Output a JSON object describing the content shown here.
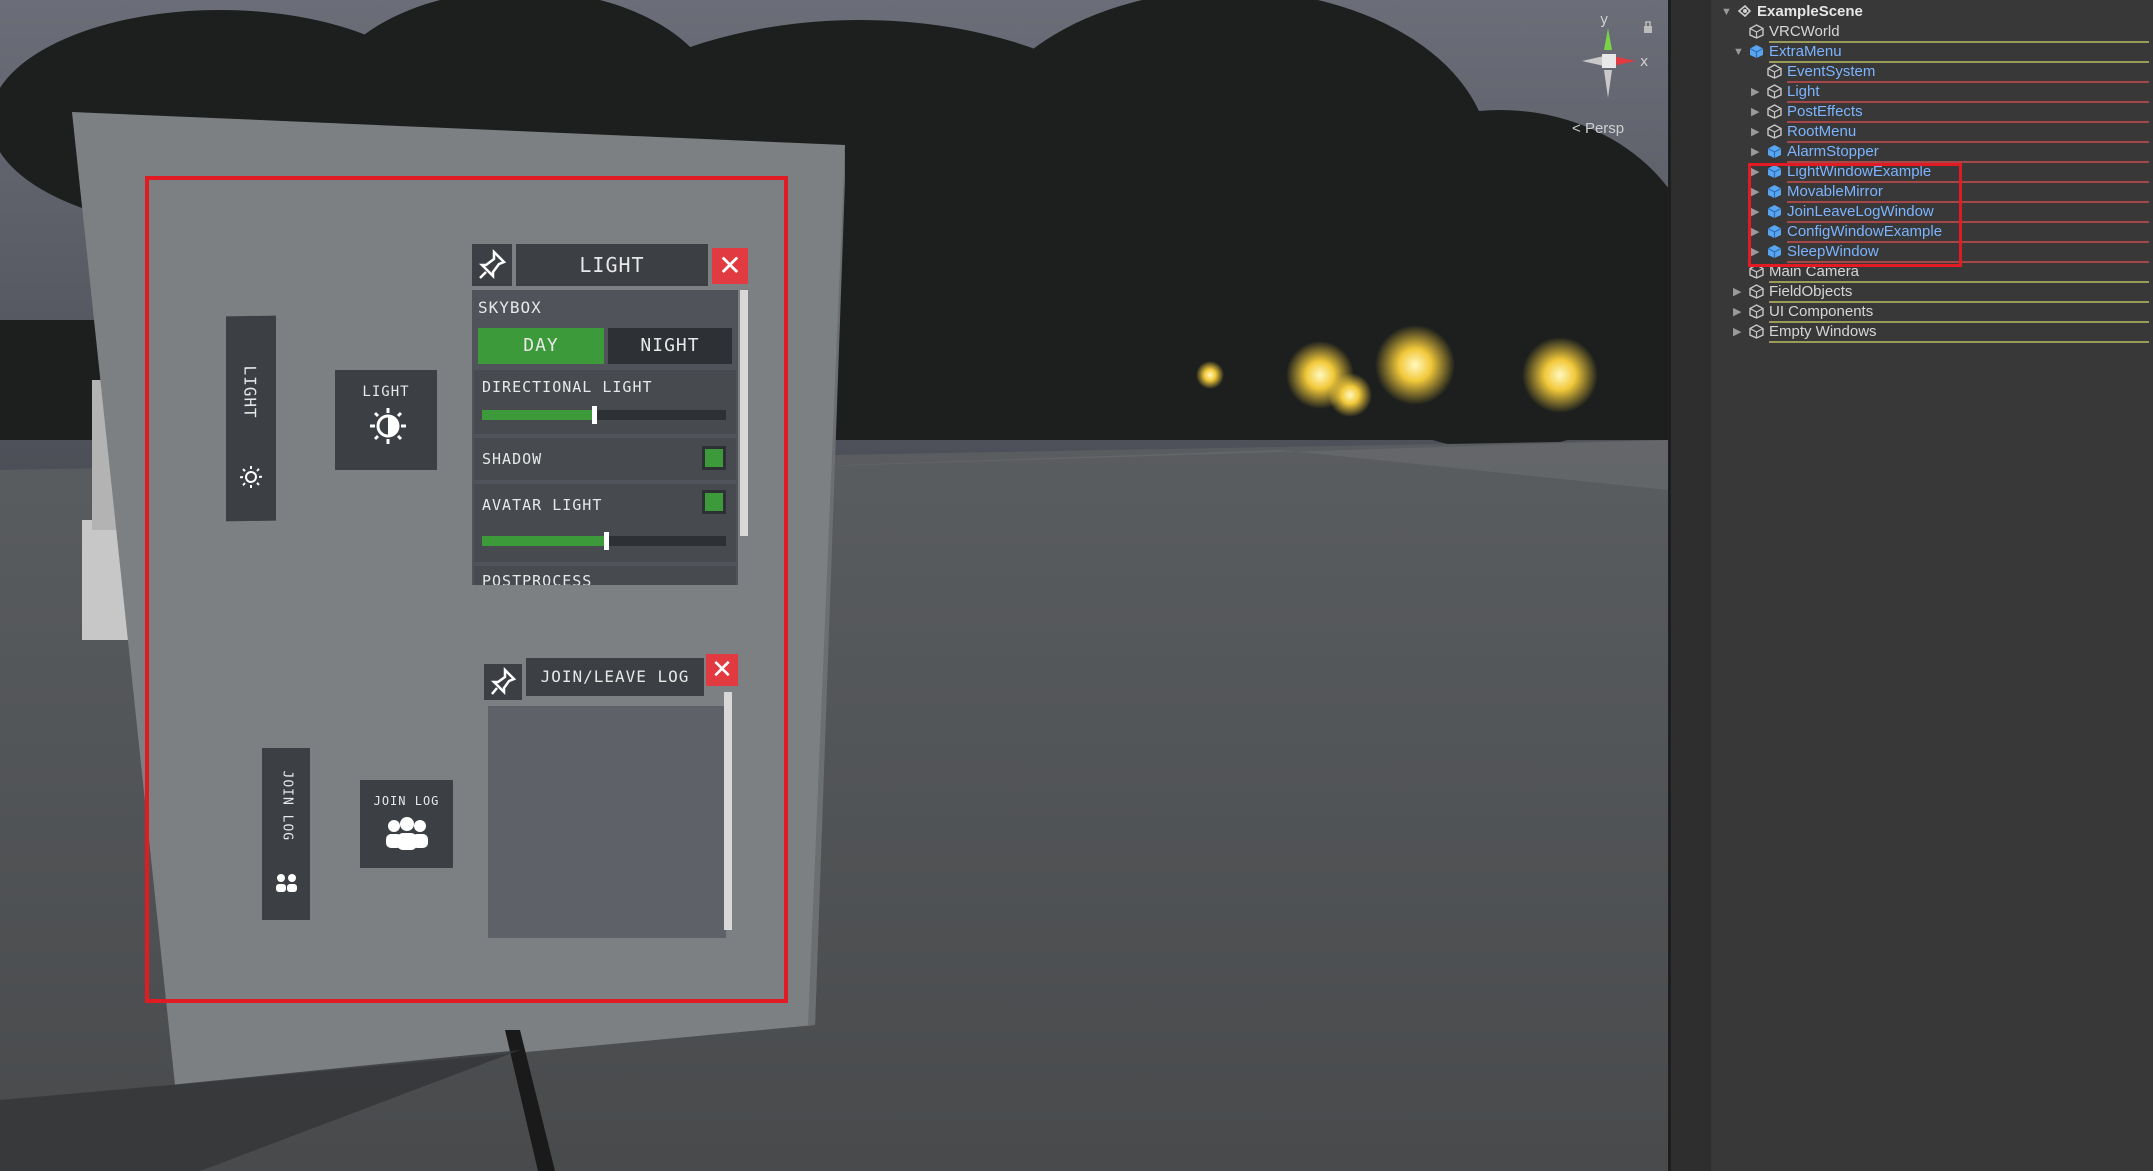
{
  "scene": {
    "gizmo": {
      "axis_y": "y",
      "axis_x": "x",
      "projection": "Persp"
    },
    "panel": {
      "light_tab": {
        "label": "LIGHT",
        "icon": "sun-icon"
      },
      "light_button": {
        "label": "LIGHT",
        "icon": "brightness-icon"
      },
      "join_tab": {
        "label": "JOIN LOG",
        "icon": "people-icon"
      },
      "join_button": {
        "label": "JOIN LOG",
        "icon": "people-icon"
      }
    },
    "light_window": {
      "title": "LIGHT",
      "pin_icon": "pin-icon",
      "close_icon": "close-icon",
      "skybox_label": "SKYBOX",
      "day_label": "DAY",
      "night_label": "NIGHT",
      "skybox_selected": "DAY",
      "directional_label": "DIRECTIONAL LIGHT",
      "directional_value": 0.45,
      "shadow_label": "SHADOW",
      "shadow_checked": true,
      "avatar_label": "AVATAR LIGHT",
      "avatar_checked": true,
      "avatar_value": 0.5,
      "postprocess_label": "POSTPROCESS"
    },
    "join_window": {
      "title": "JOIN/LEAVE LOG",
      "pin_icon": "pin-icon",
      "close_icon": "close-icon"
    }
  },
  "hierarchy": {
    "root": "ExampleScene",
    "items": [
      {
        "label": "VRCWorld",
        "depth": 1,
        "expander": "none",
        "icon": "gameobject-icon",
        "color": "#d6d6d6",
        "line": "#9a9a5a"
      },
      {
        "label": "ExtraMenu",
        "depth": 1,
        "expander": "open",
        "icon": "prefab-icon",
        "color": "#7cb4ff",
        "line": "#9a9a5a"
      },
      {
        "label": "EventSystem",
        "depth": 2,
        "expander": "none",
        "icon": "gameobject-icon",
        "color": "#7cb4ff",
        "line": "#a64646"
      },
      {
        "label": "Light",
        "depth": 2,
        "expander": "closed",
        "icon": "gameobject-icon",
        "color": "#7cb4ff",
        "line": "#a64646"
      },
      {
        "label": "PostEffects",
        "depth": 2,
        "expander": "closed",
        "icon": "gameobject-icon",
        "color": "#7cb4ff",
        "line": "#a64646"
      },
      {
        "label": "RootMenu",
        "depth": 2,
        "expander": "closed",
        "icon": "gameobject-icon",
        "color": "#7cb4ff",
        "line": "#a64646"
      },
      {
        "label": "AlarmStopper",
        "depth": 2,
        "expander": "closed",
        "icon": "prefab-icon",
        "color": "#7cb4ff",
        "line": "#a64646"
      },
      {
        "label": "LightWindowExample",
        "depth": 2,
        "expander": "closed",
        "icon": "prefab-icon",
        "color": "#7cb4ff",
        "line": "#a64646"
      },
      {
        "label": "MovableMirror",
        "depth": 2,
        "expander": "closed",
        "icon": "prefab-icon",
        "color": "#7cb4ff",
        "line": "#a64646"
      },
      {
        "label": "JoinLeaveLogWindow",
        "depth": 2,
        "expander": "closed",
        "icon": "prefab-icon",
        "color": "#7cb4ff",
        "line": "#a64646"
      },
      {
        "label": "ConfigWindowExample",
        "depth": 2,
        "expander": "closed",
        "icon": "prefab-icon",
        "color": "#7cb4ff",
        "line": "#a64646"
      },
      {
        "label": "SleepWindow",
        "depth": 2,
        "expander": "closed",
        "icon": "prefab-icon",
        "color": "#7cb4ff",
        "line": "#a64646"
      },
      {
        "label": "Main Camera",
        "depth": 1,
        "expander": "none",
        "icon": "gameobject-icon",
        "color": "#d6d6d6",
        "line": "#9a9a5a"
      },
      {
        "label": "FieldObjects",
        "depth": 1,
        "expander": "closed",
        "icon": "gameobject-icon",
        "color": "#d6d6d6",
        "line": "#9a9a5a"
      },
      {
        "label": "UI Components",
        "depth": 1,
        "expander": "closed",
        "icon": "gameobject-icon",
        "color": "#d6d6d6",
        "line": "#9a9a5a"
      },
      {
        "label": "Empty Windows",
        "depth": 1,
        "expander": "closed",
        "icon": "gameobject-icon",
        "color": "#d6d6d6",
        "line": "#9a9a5a"
      }
    ]
  },
  "colors": {
    "highlight_red": "#e01b24",
    "toggle_green": "#3c9a3a",
    "prefab_blue": "#7cb4ff"
  }
}
